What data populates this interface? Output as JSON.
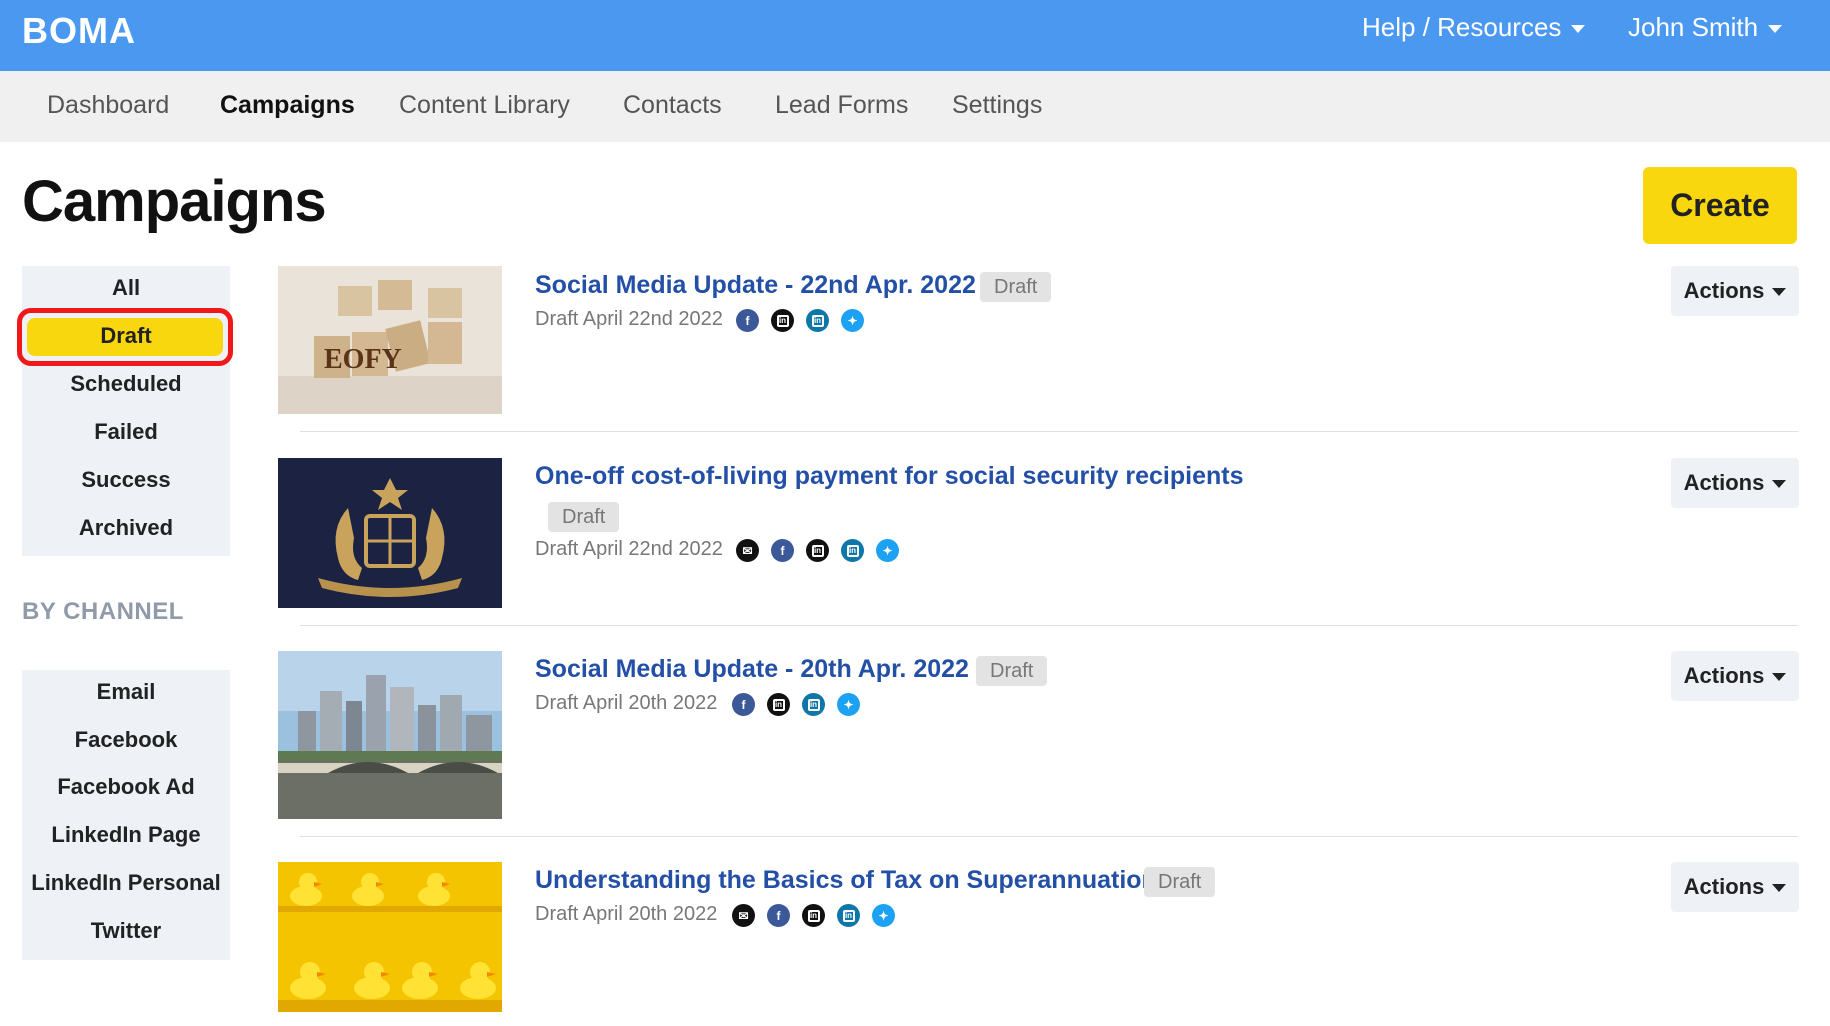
{
  "header": {
    "logo": "BOMA",
    "help_label": "Help / Resources",
    "user_label": "John Smith"
  },
  "nav": {
    "tabs": [
      "Dashboard",
      "Campaigns",
      "Content Library",
      "Contacts",
      "Lead Forms",
      "Settings"
    ],
    "active": "Campaigns"
  },
  "page": {
    "title": "Campaigns",
    "create_label": "Create"
  },
  "sidebar": {
    "status_items": [
      "All",
      "Draft",
      "Scheduled",
      "Failed",
      "Success",
      "Archived"
    ],
    "selected_status": "Draft",
    "channel_heading": "BY CHANNEL",
    "channel_items": [
      "Email",
      "Facebook",
      "Facebook Ad",
      "LinkedIn Page",
      "LinkedIn Personal",
      "Twitter"
    ]
  },
  "campaigns": [
    {
      "title": "Social Media Update - 22nd Apr. 2022",
      "badge": "Draft",
      "meta": "Draft April 22nd 2022",
      "channels": [
        "facebook-icon",
        "linkedin-personal-icon",
        "linkedin-page-icon",
        "twitter-icon"
      ],
      "thumbnail": "wooden-blocks-eofy",
      "thumbnail_text": "EOFY",
      "actions_label": "Actions"
    },
    {
      "title": "One-off cost-of-living payment for social security recipients",
      "badge": "Draft",
      "meta": "Draft April 22nd 2022",
      "channels": [
        "email-icon",
        "facebook-icon",
        "linkedin-personal-icon",
        "linkedin-page-icon",
        "twitter-icon"
      ],
      "thumbnail": "coat-of-arms",
      "actions_label": "Actions"
    },
    {
      "title": "Social Media Update - 20th Apr. 2022",
      "badge": "Draft",
      "meta": "Draft April 20th 2022",
      "channels": [
        "facebook-icon",
        "linkedin-personal-icon",
        "linkedin-page-icon",
        "twitter-icon"
      ],
      "thumbnail": "city-bridge",
      "actions_label": "Actions"
    },
    {
      "title": "Understanding the Basics of Tax on Superannuation",
      "badge": "Draft",
      "meta": "Draft April 20th 2022",
      "channels": [
        "email-icon",
        "facebook-icon",
        "linkedin-personal-icon",
        "linkedin-page-icon",
        "twitter-icon"
      ],
      "thumbnail": "rubber-ducks",
      "actions_label": "Actions"
    }
  ],
  "colors": {
    "header_blue": "#4a98f0",
    "accent_yellow": "#f8d70f",
    "link_blue": "#234fa6",
    "highlight_red": "#f01818"
  }
}
